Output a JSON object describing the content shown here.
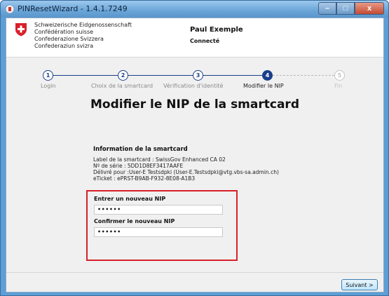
{
  "window": {
    "title": "PINResetWizard - 1.4.1.7249",
    "minimize": "–",
    "maximize": "□",
    "close": "x"
  },
  "header": {
    "federation_lines": [
      "Schweizerische Eidgenossenschaft",
      "Confédération suisse",
      "Confederazione Svizzera",
      "Confederaziun svizra"
    ],
    "user_name": "Paul Exemple",
    "user_status": "Connecté",
    "flag_color": "#d8202a"
  },
  "stepper": {
    "steps": [
      {
        "number": "1",
        "label": "Login",
        "state": "done"
      },
      {
        "number": "2",
        "label": "Choix de la smartcard",
        "state": "done"
      },
      {
        "number": "3",
        "label": "Vérification d'identité",
        "state": "done"
      },
      {
        "number": "4",
        "label": "Modifier le NIP",
        "state": "active"
      },
      {
        "number": "5",
        "label": "Fin",
        "state": "todo"
      }
    ],
    "accent_color": "#1b3f8a"
  },
  "main": {
    "title": "Modifier le NIP de la smartcard",
    "info": {
      "heading": "Information de la smartcard",
      "lines": [
        "Label de la smartcard : SwissGov Enhanced CA 02",
        "Nº de série : 5DD1D8EF3417AAFE",
        "Délivré pour :User-E Testsdpki (User-E.Testsdpki@vtg.vbs-sa.admin.ch)",
        "eTicket : ePRST-B9AB-F932-8E08-A1B3"
      ]
    },
    "new_pin": {
      "label": "Entrer un nouveau NIP",
      "value": "••••••"
    },
    "confirm_pin": {
      "label": "Confirmer le nouveau NIP",
      "value": "••••••"
    },
    "highlight_color": "#d8202a"
  },
  "footer": {
    "next_label": "Suivant >"
  }
}
